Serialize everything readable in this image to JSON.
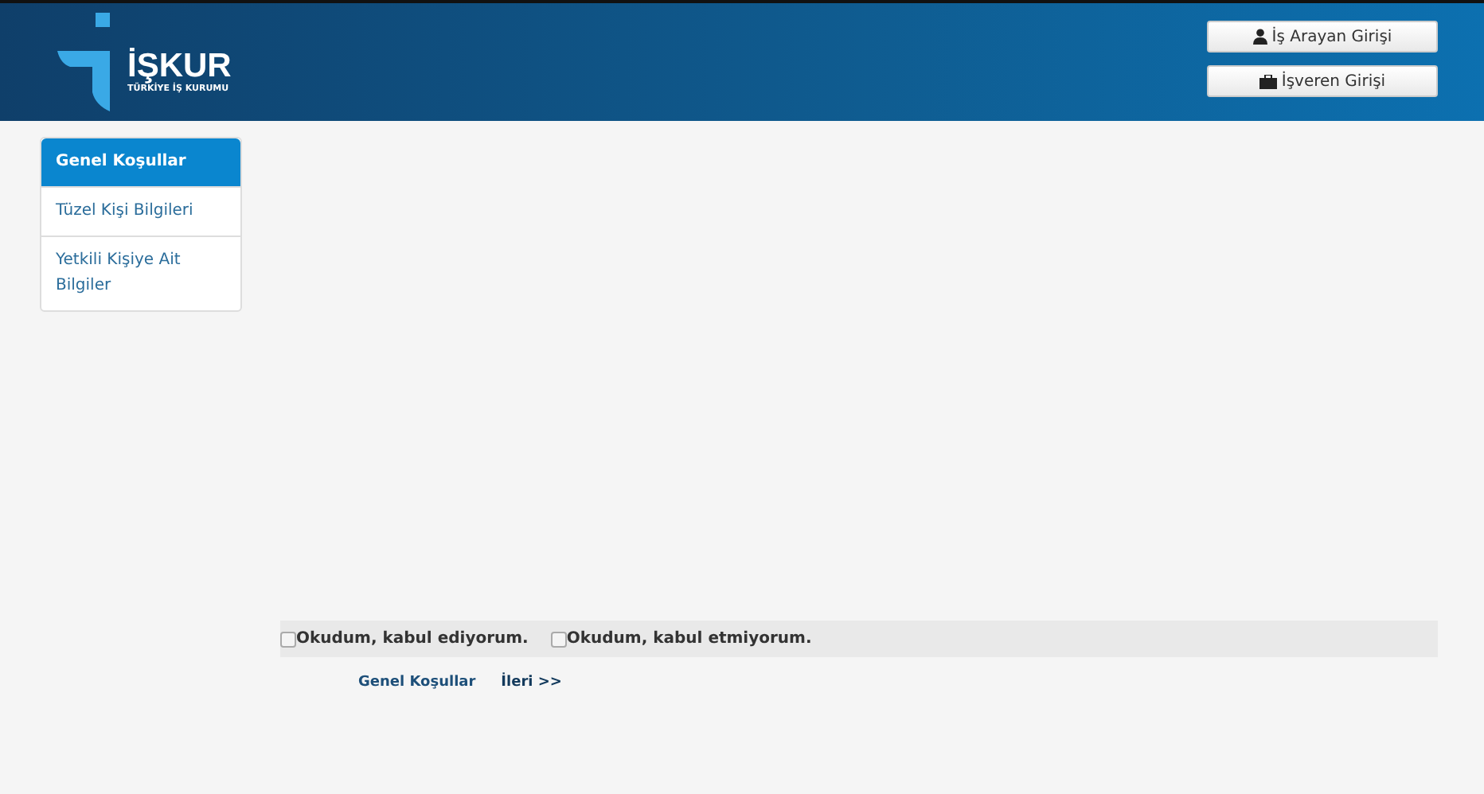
{
  "logo": {
    "name": "İŞKUR",
    "subtitle": "TÜRKİYE İŞ KURUMU"
  },
  "header_buttons": [
    {
      "label": "İş Arayan Girişi",
      "kind": "person"
    },
    {
      "label": "İşveren Girişi",
      "kind": "briefcase"
    }
  ],
  "sidebar": {
    "items": [
      {
        "label": "Genel Koşullar",
        "selected": true
      },
      {
        "label": "Tüzel Kişi Bilgileri",
        "selected": false
      },
      {
        "label": "Yetkili Kişiye Ait Bilgiler",
        "selected": false
      }
    ]
  },
  "agreement": [
    {
      "label": "Okudum, kabul ediyorum.",
      "checked": false
    },
    {
      "label": "Okudum, kabul etmiyorum.",
      "checked": false
    }
  ],
  "nav_links": [
    {
      "label": "Genel Koşullar",
      "kind": "back"
    },
    {
      "label": "İleri >>",
      "kind": "next"
    }
  ]
}
